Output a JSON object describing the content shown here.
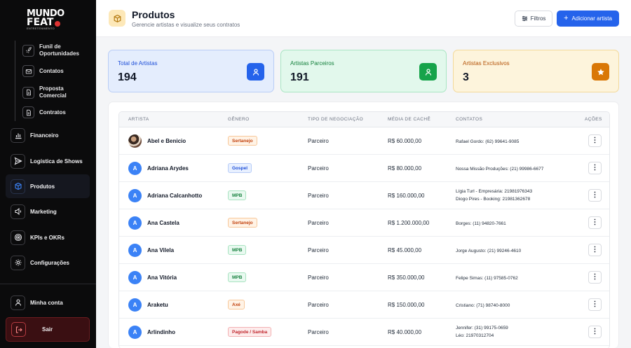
{
  "brand": {
    "line1": "MUNDO",
    "line2": "FEAT",
    "line3": "ENTRETENIMENTO"
  },
  "sidebar": {
    "subitems": [
      {
        "label": "Funil de Oportunidades",
        "icon": "rocket-icon"
      },
      {
        "label": "Contatos",
        "icon": "mail-icon"
      },
      {
        "label": "Proposta Comercial",
        "icon": "document-icon"
      },
      {
        "label": "Contratos",
        "icon": "document-icon"
      }
    ],
    "items": [
      {
        "label": "Financeiro",
        "icon": "bar-chart-icon"
      },
      {
        "label": "Logística de Shows",
        "icon": "send-icon"
      },
      {
        "label": "Produtos",
        "icon": "cube-icon",
        "active": true
      },
      {
        "label": "Marketing",
        "icon": "megaphone-icon"
      },
      {
        "label": "KPIs e OKRs",
        "icon": "target-icon"
      },
      {
        "label": "Configurações",
        "icon": "gear-icon"
      }
    ],
    "account_label": "Minha conta",
    "logout_label": "Sair"
  },
  "header": {
    "title": "Produtos",
    "subtitle": "Gerencie artistas e visualize seus contratos",
    "filter_label": "Filtros",
    "add_label": "Adicionar artista"
  },
  "stats": [
    {
      "label": "Total de Artistas",
      "value": "194",
      "icon": "user-icon",
      "color": "#2563eb"
    },
    {
      "label": "Artistas Parceiros",
      "value": "191",
      "icon": "user-icon",
      "color": "#16a34a"
    },
    {
      "label": "Artistas Exclusivos",
      "value": "3",
      "icon": "star-icon",
      "color": "#d97706"
    }
  ],
  "table": {
    "columns": [
      "ARTISTA",
      "GÊNERO",
      "TIPO DE NEGOCIAÇÃO",
      "MÉDIA DE CACHÊ",
      "CONTATOS",
      "AÇÕES"
    ],
    "rows": [
      {
        "initial": "",
        "name": "Abel e Benicio",
        "genre": "Sertanejo",
        "genre_color": "orange",
        "tipo": "Parceiro",
        "cache": "R$ 60.000,00",
        "contacts": [
          "Rafael Gordo: (62) 99641-9085"
        ],
        "action": "⋮"
      },
      {
        "initial": "A",
        "name": "Adriana Arydes",
        "genre": "Gospel",
        "genre_color": "blue",
        "tipo": "Parceiro",
        "cache": "R$ 80.000,00",
        "contacts": [
          "Nossa Missão Produções: (21) 99986-6677"
        ],
        "action": "⋮"
      },
      {
        "initial": "A",
        "name": "Adriana Calcanhotto",
        "genre": "MPB",
        "genre_color": "green",
        "tipo": "Parceiro",
        "cache": "R$ 160.000,00",
        "contacts": [
          "Lígia Turl - Empresária: 21981976343",
          "Diogo Pires - Booking: 21981362678"
        ],
        "action": "⋮"
      },
      {
        "initial": "A",
        "name": "Ana Castela",
        "genre": "Sertanejo",
        "genre_color": "orange",
        "tipo": "Parceiro",
        "cache": "R$ 1.200.000,00",
        "contacts": [
          "Borges: (11) 94820-7661"
        ],
        "action": "⋮"
      },
      {
        "initial": "A",
        "name": "Ana Vilela",
        "genre": "MPB",
        "genre_color": "green",
        "tipo": "Parceiro",
        "cache": "R$ 45.000,00",
        "contacts": [
          "Jorge Augusto: (21) 99246-4610"
        ],
        "action": "⋮"
      },
      {
        "initial": "A",
        "name": "Ana Vitória",
        "genre": "MPB",
        "genre_color": "green",
        "tipo": "Parceiro",
        "cache": "R$ 350.000,00",
        "contacts": [
          "Felipe Simas: (11) 97585-0762"
        ],
        "action": "⋮"
      },
      {
        "initial": "A",
        "name": "Araketu",
        "genre": "Axé",
        "genre_color": "orange",
        "tipo": "Parceiro",
        "cache": "R$ 150.000,00",
        "contacts": [
          "Cristiano: (71) 98740-8000"
        ],
        "action": "⋮"
      },
      {
        "initial": "A",
        "name": "Arlindinho",
        "genre": "Pagode / Samba",
        "genre_color": "red",
        "tipo": "Parceiro",
        "cache": "R$ 40.000,00",
        "contacts": [
          "Jennifer: (31) 99175-0659",
          "Léo: 21970312704"
        ],
        "action": "⋮"
      }
    ]
  }
}
